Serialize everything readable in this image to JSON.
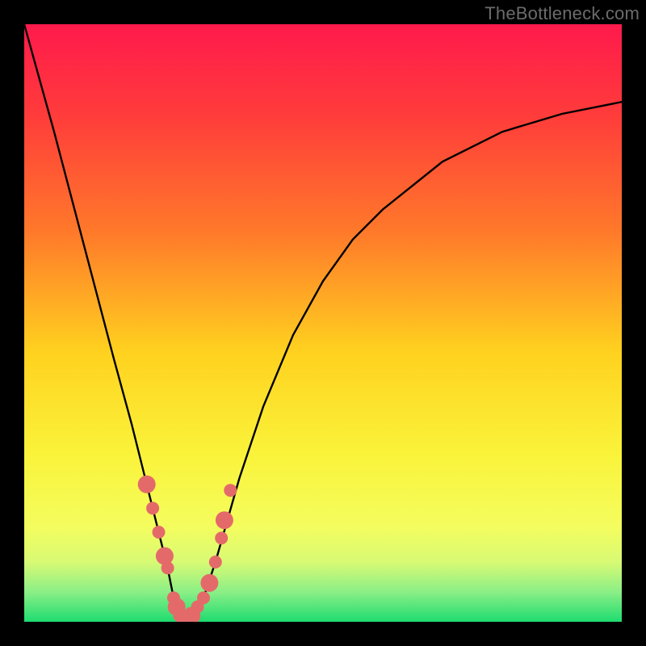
{
  "watermark": "TheBottleneck.com",
  "chart_data": {
    "type": "line",
    "title": "",
    "xlabel": "",
    "ylabel": "",
    "xlim": [
      0,
      1
    ],
    "ylim": [
      0,
      1
    ],
    "x": [
      0.0,
      0.05,
      0.1,
      0.15,
      0.18,
      0.2,
      0.22,
      0.24,
      0.25,
      0.26,
      0.27,
      0.28,
      0.3,
      0.32,
      0.34,
      0.36,
      0.4,
      0.45,
      0.5,
      0.55,
      0.6,
      0.7,
      0.8,
      0.9,
      1.0
    ],
    "y": [
      1.0,
      0.82,
      0.63,
      0.44,
      0.33,
      0.25,
      0.17,
      0.09,
      0.04,
      0.01,
      0.0,
      0.01,
      0.04,
      0.1,
      0.17,
      0.24,
      0.36,
      0.48,
      0.57,
      0.64,
      0.69,
      0.77,
      0.82,
      0.85,
      0.87
    ],
    "markers": {
      "x": [
        0.205,
        0.215,
        0.225,
        0.235,
        0.24,
        0.25,
        0.255,
        0.26,
        0.27,
        0.28,
        0.29,
        0.3,
        0.31,
        0.32,
        0.33,
        0.335,
        0.345
      ],
      "y": [
        0.23,
        0.19,
        0.15,
        0.11,
        0.09,
        0.04,
        0.025,
        0.01,
        0.0,
        0.01,
        0.025,
        0.04,
        0.065,
        0.1,
        0.14,
        0.17,
        0.22
      ]
    },
    "gradient_stops": [
      {
        "offset": 0.0,
        "color": "#ff1a4c"
      },
      {
        "offset": 0.15,
        "color": "#ff3b3b"
      },
      {
        "offset": 0.35,
        "color": "#ff7a2a"
      },
      {
        "offset": 0.55,
        "color": "#ffd21f"
      },
      {
        "offset": 0.72,
        "color": "#faf33a"
      },
      {
        "offset": 0.84,
        "color": "#f4fd5e"
      },
      {
        "offset": 0.9,
        "color": "#d8fa74"
      },
      {
        "offset": 0.95,
        "color": "#8bef86"
      },
      {
        "offset": 1.0,
        "color": "#1edc70"
      }
    ],
    "curve_stroke": "#000000",
    "marker_fill": "#e46a6a"
  }
}
